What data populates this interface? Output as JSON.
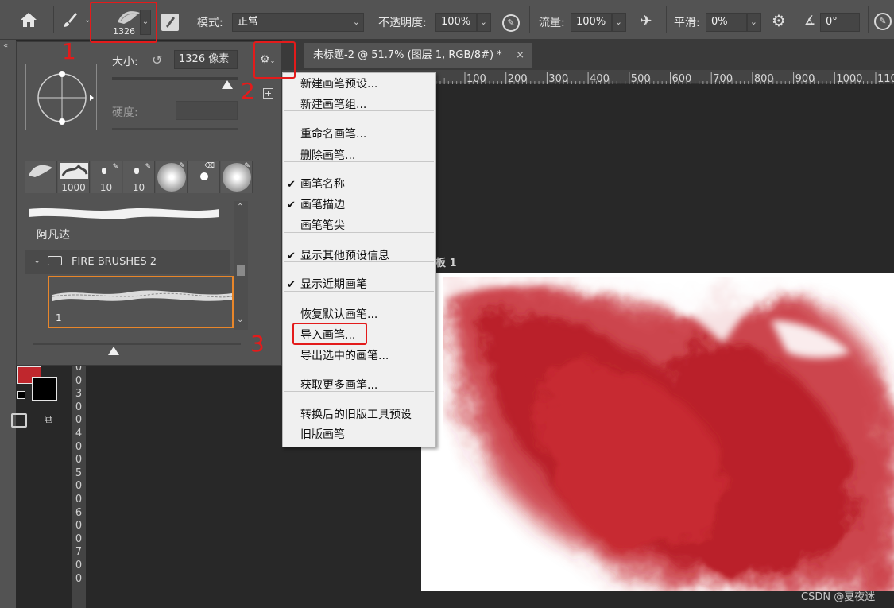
{
  "optionsbar": {
    "brush_preset_size": "1326",
    "mode_label": "模式:",
    "mode_value": "正常",
    "opacity_label": "不透明度:",
    "opacity_value": "100%",
    "flow_label": "流量:",
    "flow_value": "100%",
    "smooth_label": "平滑:",
    "smooth_value": "0%",
    "angle_value": "0°"
  },
  "doc_tab": {
    "title": "未标题-2 @ 51.7% (图层 1, RGB/8#) *",
    "close": "×"
  },
  "ruler": {
    "h_ticks": [
      "100",
      "200",
      "300",
      "400",
      "500",
      "600",
      "700",
      "800",
      "900",
      "1000",
      "110"
    ],
    "v_digits": [
      "0",
      "0",
      "3",
      "0",
      "0",
      "4",
      "0",
      "0",
      "5",
      "0",
      "0",
      "6",
      "0",
      "0",
      "7",
      "0",
      "0"
    ]
  },
  "artboard_label": "板 1",
  "brush_panel": {
    "size_label": "大小:",
    "size_value": "1326 像素",
    "hardness_label": "硬度:",
    "thumbs": [
      "1326",
      "1000",
      "10",
      "10",
      "",
      "",
      ""
    ],
    "brush_name": "阿凡达",
    "folder_name": "FIRE BRUSHES 2",
    "selected_brush_num": "1"
  },
  "menu": {
    "items": [
      {
        "label": "新建画笔预设...",
        "checked": false
      },
      {
        "label": "新建画笔组...",
        "checked": false
      },
      {
        "label": "重命名画笔...",
        "checked": false
      },
      {
        "label": "删除画笔...",
        "checked": false
      },
      {
        "label": "画笔名称",
        "checked": true
      },
      {
        "label": "画笔描边",
        "checked": true
      },
      {
        "label": "画笔笔尖",
        "checked": false
      },
      {
        "label": "显示其他预设信息",
        "checked": true
      },
      {
        "label": "显示近期画笔",
        "checked": true
      },
      {
        "label": "恢复默认画笔...",
        "checked": false
      },
      {
        "label": "导入画笔...",
        "checked": false
      },
      {
        "label": "导出选中的画笔...",
        "checked": false
      },
      {
        "label": "获取更多画笔...",
        "checked": false
      },
      {
        "label": "转换后的旧版工具预设",
        "checked": false
      },
      {
        "label": "旧版画笔",
        "checked": false
      }
    ],
    "check_glyph": "✔"
  },
  "annotations": [
    "1",
    "2",
    "3"
  ],
  "colors": {
    "foreground": "#c0272d",
    "background": "#000000",
    "highlight": "#e31b1b",
    "selection": "#e8862a"
  },
  "watermark": "CSDN @夏夜迷"
}
